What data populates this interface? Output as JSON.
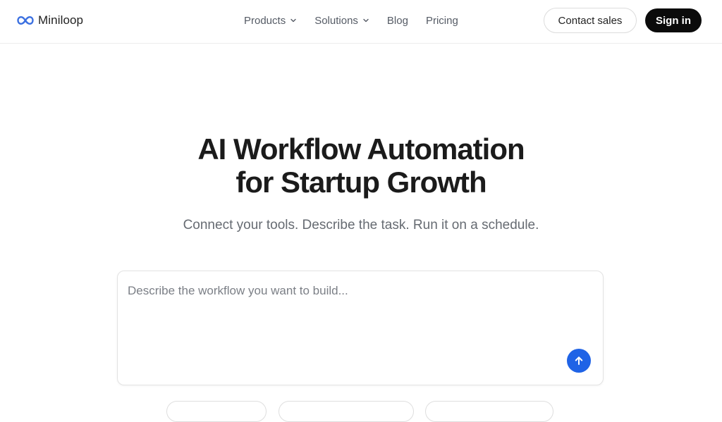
{
  "brand": {
    "name": "Miniloop",
    "icon": "infinity-logo-icon",
    "color": "#3a6fe0"
  },
  "nav": {
    "items": [
      {
        "label": "Products",
        "has_dropdown": true
      },
      {
        "label": "Solutions",
        "has_dropdown": true
      },
      {
        "label": "Blog",
        "has_dropdown": false
      },
      {
        "label": "Pricing",
        "has_dropdown": false
      }
    ],
    "contact_label": "Contact sales",
    "signin_label": "Sign in"
  },
  "hero": {
    "title_line1": "AI Workflow Automation",
    "title_line2": "for Startup Growth",
    "subtitle": "Connect your tools. Describe the task. Run it on a schedule."
  },
  "prompt": {
    "placeholder": "Describe the workflow you want to build...",
    "value": "",
    "send_icon": "arrow-up-icon",
    "send_color": "#1f63e6"
  },
  "colors": {
    "accent": "#1f63e6",
    "signin_bg": "#0b0b0b"
  }
}
